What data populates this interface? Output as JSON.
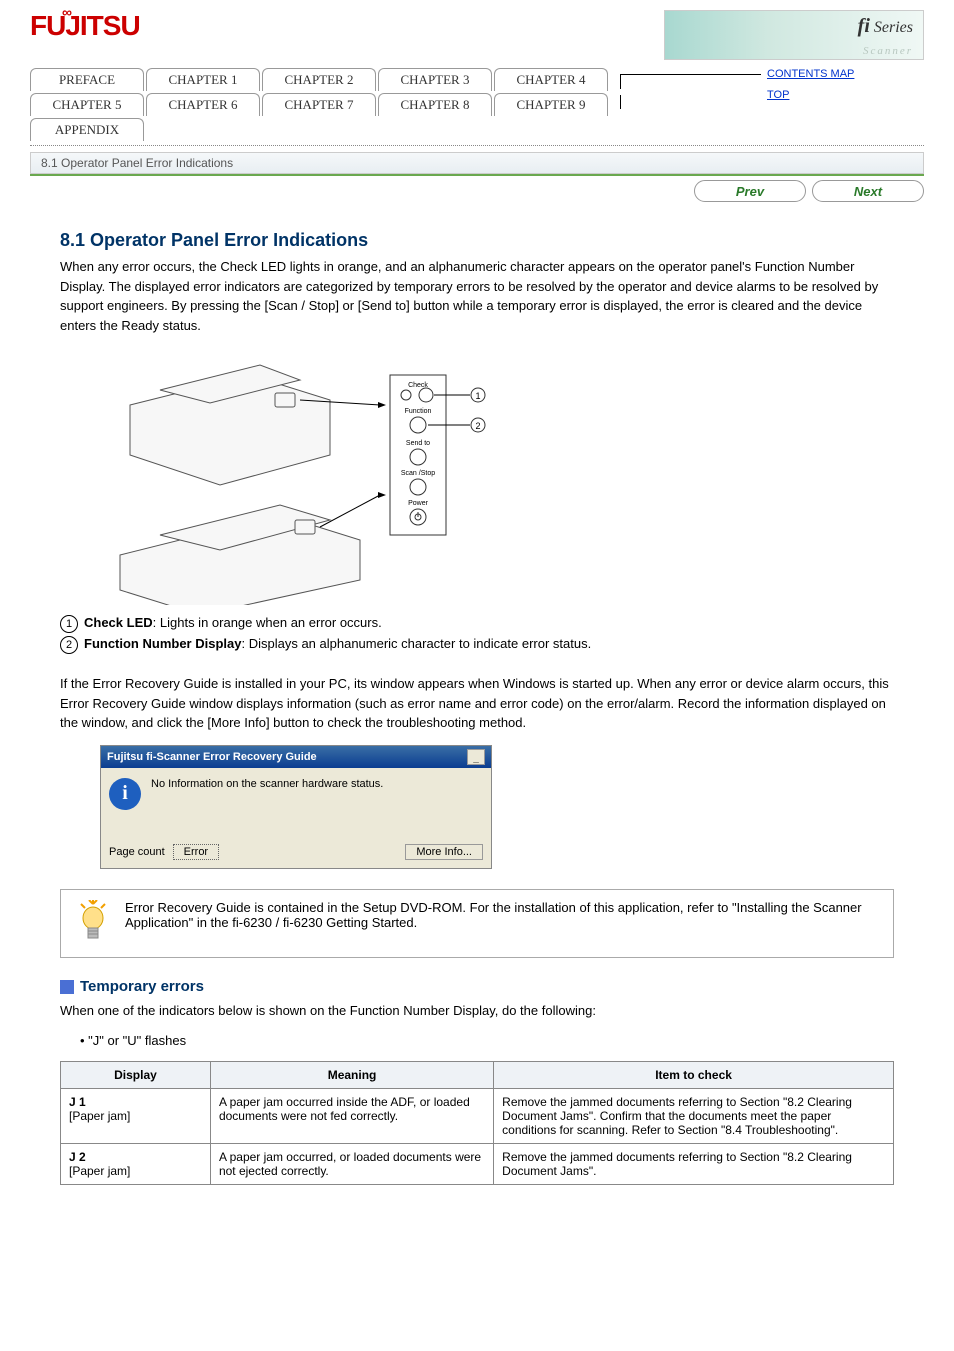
{
  "header": {
    "logo_text": "FUJITSU",
    "banner_fi": "fi",
    "banner_series": "Series",
    "banner_scanner": "Scanner"
  },
  "nav": {
    "row1": [
      "PREFACE",
      "CHAPTER 1",
      "CHAPTER 2",
      "CHAPTER 3",
      "CHAPTER 4"
    ],
    "row2": [
      "CHAPTER 5",
      "CHAPTER 6",
      "CHAPTER 7",
      "CHAPTER 8",
      "CHAPTER 9"
    ],
    "row3": [
      "APPENDIX"
    ],
    "side_links": [
      "CONTENTS MAP",
      "TOP"
    ],
    "section_label": "8.1 Operator Panel Error Indications"
  },
  "prevnext": {
    "prev": "Prev",
    "next": "Next"
  },
  "body": {
    "title": "8.1 Operator Panel Error Indications",
    "intro": "When any error occurs, the Check LED lights in orange, and an alphanumeric character appears on the operator panel's Function Number Display. The displayed error indicators are categorized by temporary errors to be resolved by the operator and device alarms to be resolved by support engineers. By pressing the [Scan / Stop] or [Send to] button while a temporary error is displayed, the error is cleared and the device enters the Ready status.",
    "panel_labels": [
      "Check",
      "Function",
      "Send to",
      "Scan /Stop",
      "Power"
    ],
    "callout1_label": "Check LED",
    "callout1_text": "Lights in orange when an error occurs.",
    "callout2_label": "Function Number Display",
    "callout2_text": "Displays an alphanumeric character to indicate error status.",
    "para2": "If the Error Recovery Guide is installed in your PC, its window appears when Windows is started up. When any error or device alarm occurs, this Error Recovery Guide window displays information (such as error name and error code) on the error/alarm. Record the information displayed on the window, and click the [More Info] button to check the troubleshooting method.",
    "dialog": {
      "title": "Fujitsu fi-Scanner Error Recovery Guide",
      "message": "No Information on the scanner hardware status.",
      "page_count": "Page count",
      "error_btn": "Error",
      "more_info": "More Info..."
    },
    "hint": "Error Recovery Guide is contained in the Setup DVD-ROM. For the installation of this application, refer to \"Installing the Scanner Application\" in the fi-6230 / fi-6230 Getting Started.",
    "sub_title": "Temporary errors",
    "sub_para": "When one of the indicators below is shown on the Function Number Display, do the following:",
    "sub_bullet": "\"J\" or \"U\" flashes",
    "table": {
      "h_display": "Display",
      "h_meaning": "Meaning",
      "h_item": "Item to check",
      "rows": [
        {
          "display_code": "J 1",
          "display_text": "[Paper jam]",
          "meaning": "A paper jam occurred inside the ADF, or loaded documents were not fed correctly.",
          "item": "Remove the jammed documents referring to Section \"8.2 Clearing Document Jams\". Confirm that the documents meet the paper conditions for scanning. Refer to Section \"8.4 Troubleshooting\"."
        },
        {
          "display_code": "J 2",
          "display_text": "[Paper jam]",
          "meaning": "A paper jam occurred, or loaded documents were not ejected correctly.",
          "item": "Remove the jammed documents referring to Section \"8.2 Clearing Document Jams\"."
        }
      ]
    }
  }
}
